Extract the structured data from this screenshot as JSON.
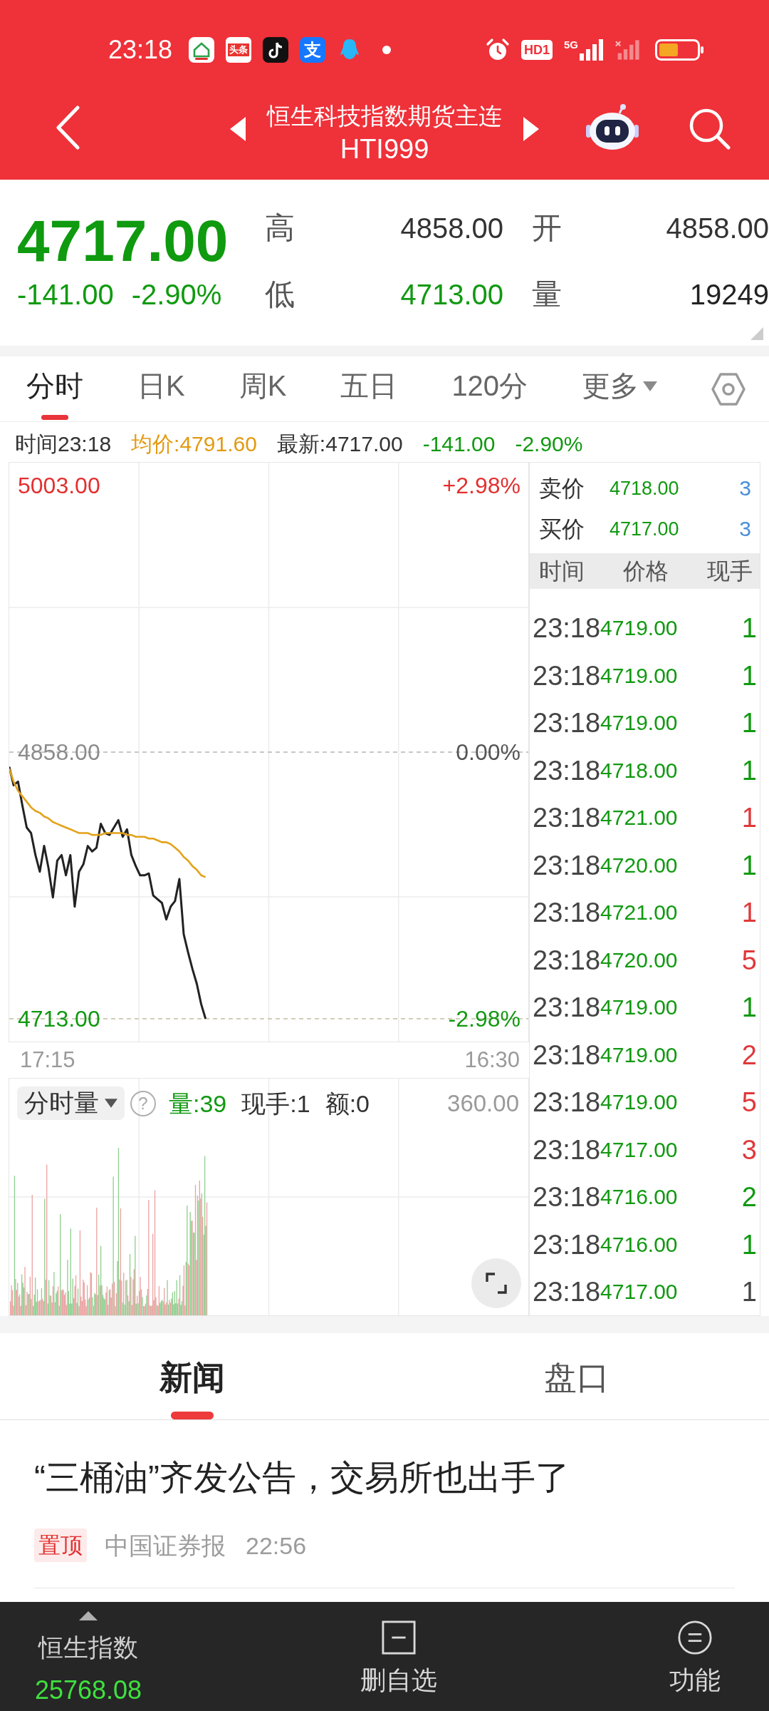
{
  "status_bar": {
    "time": "23:18",
    "notifications": [
      {
        "kind": "home"
      },
      {
        "kind": "toutiao",
        "label": "头条"
      },
      {
        "kind": "tiktok"
      },
      {
        "kind": "alipay",
        "label": "支"
      },
      {
        "kind": "qq"
      }
    ],
    "hd_label": "HD1",
    "network_label": "5G"
  },
  "header": {
    "title": "恒生科技指数期货主连",
    "code": "HTI999"
  },
  "quote": {
    "price": "4717.00",
    "change": "-141.00",
    "change_percent": "-2.90%",
    "falling": true,
    "stats": [
      {
        "label": "高",
        "value": "4858.00",
        "color": "#333333"
      },
      {
        "label": "开",
        "value": "4858.00",
        "color": "#333333"
      },
      {
        "label": "低",
        "value": "4713.00",
        "color": "#119911"
      },
      {
        "label": "量",
        "value": "19249",
        "color": "#222222"
      }
    ]
  },
  "chart_tabs": [
    {
      "label": "分时",
      "selected": true,
      "kind": "tab"
    },
    {
      "label": "日K",
      "selected": false,
      "kind": "tab"
    },
    {
      "label": "周K",
      "selected": false,
      "kind": "tab"
    },
    {
      "label": "五日",
      "selected": false,
      "kind": "tab"
    },
    {
      "label": "120分",
      "selected": false,
      "kind": "tab"
    },
    {
      "label": "更多",
      "selected": false,
      "kind": "dropdown"
    }
  ],
  "info_line": [
    {
      "text": "时间23:18",
      "color": "#333333"
    },
    {
      "text": "均价:4791.60",
      "color": "#e39a12"
    },
    {
      "text": "最新:4717.00",
      "color": "#333333"
    },
    {
      "text": "-141.00",
      "color": "#119911"
    },
    {
      "text": "-2.90%",
      "color": "#119911"
    }
  ],
  "price_chart": {
    "chart_data": {
      "type": "line",
      "ylim": [
        4700.6,
        5015.4
      ],
      "yticks": [
        {
          "value": 5003,
          "label": "5003.00"
        },
        {
          "value": 4858,
          "label": "4858.00"
        },
        {
          "value": 4713,
          "label": "4713.00"
        }
      ],
      "ref_lines": [
        {
          "axis": "y",
          "value": 4858,
          "color": "#b5b5b5"
        },
        {
          "axis": "y",
          "value": 4713,
          "color": "#c4bf9e"
        }
      ],
      "categories": [
        null,
        null,
        null,
        null,
        null,
        null,
        null,
        null,
        null,
        null,
        null,
        null,
        null,
        null,
        null,
        null,
        null,
        null,
        null,
        null,
        null,
        null,
        null,
        null,
        null,
        null,
        null,
        null,
        null,
        null,
        null,
        null,
        null,
        null,
        null,
        null,
        null,
        null,
        null,
        null,
        null,
        null,
        null,
        null,
        null,
        null,
        null,
        null,
        null,
        null,
        null,
        null,
        null,
        null,
        null,
        null,
        null,
        null,
        null,
        null,
        null,
        null,
        null,
        null,
        null,
        null,
        null,
        null,
        null,
        null,
        null,
        null,
        null,
        null,
        null,
        null,
        null,
        null,
        null,
        null,
        null,
        null,
        null,
        null,
        null,
        null,
        null,
        null,
        null,
        null,
        null,
        null,
        null,
        null,
        null,
        null,
        null,
        null,
        null,
        null,
        null,
        null,
        null,
        null,
        null,
        null,
        null,
        null,
        null,
        null,
        null,
        null,
        null,
        null,
        null,
        null,
        null,
        null,
        null,
        null
      ],
      "series": [
        {
          "color": "#222222",
          "values": [
            4850,
            4840,
            4842,
            4829,
            4817,
            4814,
            4802,
            4793,
            4807,
            4795,
            4779,
            4799,
            4802,
            4791,
            4802,
            4774,
            4793,
            4797,
            4807,
            4804,
            4806,
            4819,
            4814,
            4813,
            4817,
            4821,
            4812,
            4816,
            4802,
            4796,
            4791,
            4791,
            4792,
            4780,
            4778,
            4776,
            4767,
            4774,
            4777,
            4789,
            4759,
            4749,
            4740,
            4732,
            4721,
            4713,
            null,
            null,
            null,
            null,
            null,
            null,
            null,
            null,
            null,
            null,
            null,
            null,
            null,
            null,
            null,
            null,
            null,
            null,
            null,
            null,
            null,
            null,
            null,
            null,
            null,
            null,
            null,
            null,
            null,
            null,
            null,
            null,
            null,
            null,
            null,
            null,
            null,
            null,
            null,
            null,
            null,
            null,
            null,
            null,
            null,
            null,
            null,
            null,
            null,
            null,
            null,
            null,
            null,
            null,
            null,
            null,
            null,
            null,
            null,
            null,
            null,
            null,
            null,
            null,
            null,
            null,
            null,
            null,
            null,
            null,
            null,
            null,
            null,
            null
          ]
        },
        {
          "color": "#e3a21a",
          "values": [
            4849,
            4842,
            4837,
            4834,
            4831,
            4828,
            4826,
            4825,
            4823,
            4822,
            4820,
            4819,
            4818,
            4817,
            4816,
            4815,
            4814,
            4814,
            4814,
            4813,
            4813,
            4813,
            4814,
            4814,
            4814,
            4814,
            4814,
            4813,
            4813,
            4812,
            4812,
            4812,
            4811,
            4811,
            4810,
            4809,
            4809,
            4808,
            4806,
            4804,
            4801,
            4799,
            4796,
            4794,
            4791,
            4790,
            null,
            null,
            null,
            null,
            null,
            null,
            null,
            null,
            null,
            null,
            null,
            null,
            null,
            null,
            null,
            null,
            null,
            null,
            null,
            null,
            null,
            null,
            null,
            null,
            null,
            null,
            null,
            null,
            null,
            null,
            null,
            null,
            null,
            null,
            null,
            null,
            null,
            null,
            null,
            null,
            null,
            null,
            null,
            null,
            null,
            null,
            null,
            null,
            null,
            null,
            null,
            null,
            null,
            null,
            null,
            null,
            null,
            null,
            null,
            null,
            null,
            null,
            null,
            null,
            null,
            null,
            null,
            null,
            null,
            null,
            null,
            null,
            null,
            null
          ]
        }
      ]
    },
    "percent_labels": [
      "+2.98%",
      "0.00%",
      "-2.98%"
    ],
    "time_labels": [
      "17:15",
      "16:30"
    ]
  },
  "volume_panel": {
    "selector": "分时量",
    "help_symbol": "?",
    "volume": "量:39",
    "last_hand": "现手:1",
    "amount": "额:0",
    "max_label": "360.00"
  },
  "order_book": {
    "levels": [
      {
        "label": "卖价",
        "price": "4718.00",
        "quantity": "3"
      },
      {
        "label": "买价",
        "price": "4717.00",
        "quantity": "3"
      }
    ],
    "columns": [
      "时间",
      "价格",
      "现手"
    ]
  },
  "trades": [
    {
      "time": "23:18",
      "price": "4719.00",
      "volume": "1",
      "color": "#119911"
    },
    {
      "time": "23:18",
      "price": "4719.00",
      "volume": "1",
      "color": "#119911"
    },
    {
      "time": "23:18",
      "price": "4719.00",
      "volume": "1",
      "color": "#119911"
    },
    {
      "time": "23:18",
      "price": "4718.00",
      "volume": "1",
      "color": "#119911"
    },
    {
      "time": "23:18",
      "price": "4721.00",
      "volume": "1",
      "color": "#e0383a"
    },
    {
      "time": "23:18",
      "price": "4720.00",
      "volume": "1",
      "color": "#119911"
    },
    {
      "time": "23:18",
      "price": "4721.00",
      "volume": "1",
      "color": "#e0383a"
    },
    {
      "time": "23:18",
      "price": "4720.00",
      "volume": "5",
      "color": "#e0383a"
    },
    {
      "time": "23:18",
      "price": "4719.00",
      "volume": "1",
      "color": "#119911"
    },
    {
      "time": "23:18",
      "price": "4719.00",
      "volume": "2",
      "color": "#e0383a"
    },
    {
      "time": "23:18",
      "price": "4719.00",
      "volume": "5",
      "color": "#e0383a"
    },
    {
      "time": "23:18",
      "price": "4717.00",
      "volume": "3",
      "color": "#e0383a"
    },
    {
      "time": "23:18",
      "price": "4716.00",
      "volume": "2",
      "color": "#119911"
    },
    {
      "time": "23:18",
      "price": "4716.00",
      "volume": "1",
      "color": "#119911"
    },
    {
      "time": "23:18",
      "price": "4717.00",
      "volume": "1",
      "color": "#444444"
    }
  ],
  "news_tabs": [
    {
      "label": "新闻",
      "selected": true
    },
    {
      "label": "盘口",
      "selected": false
    }
  ],
  "news": [
    {
      "title": "“三桶油”齐发公告，交易所也出手了",
      "tag": "置顶",
      "source": "中国证券报",
      "time": "22:56"
    }
  ],
  "bottom_bar": {
    "index_name": "恒生指数",
    "index_value": "25768.08",
    "actions": [
      {
        "kind": "remove_watchlist",
        "label": "删自选"
      },
      {
        "kind": "functions",
        "label": "功能"
      }
    ]
  }
}
